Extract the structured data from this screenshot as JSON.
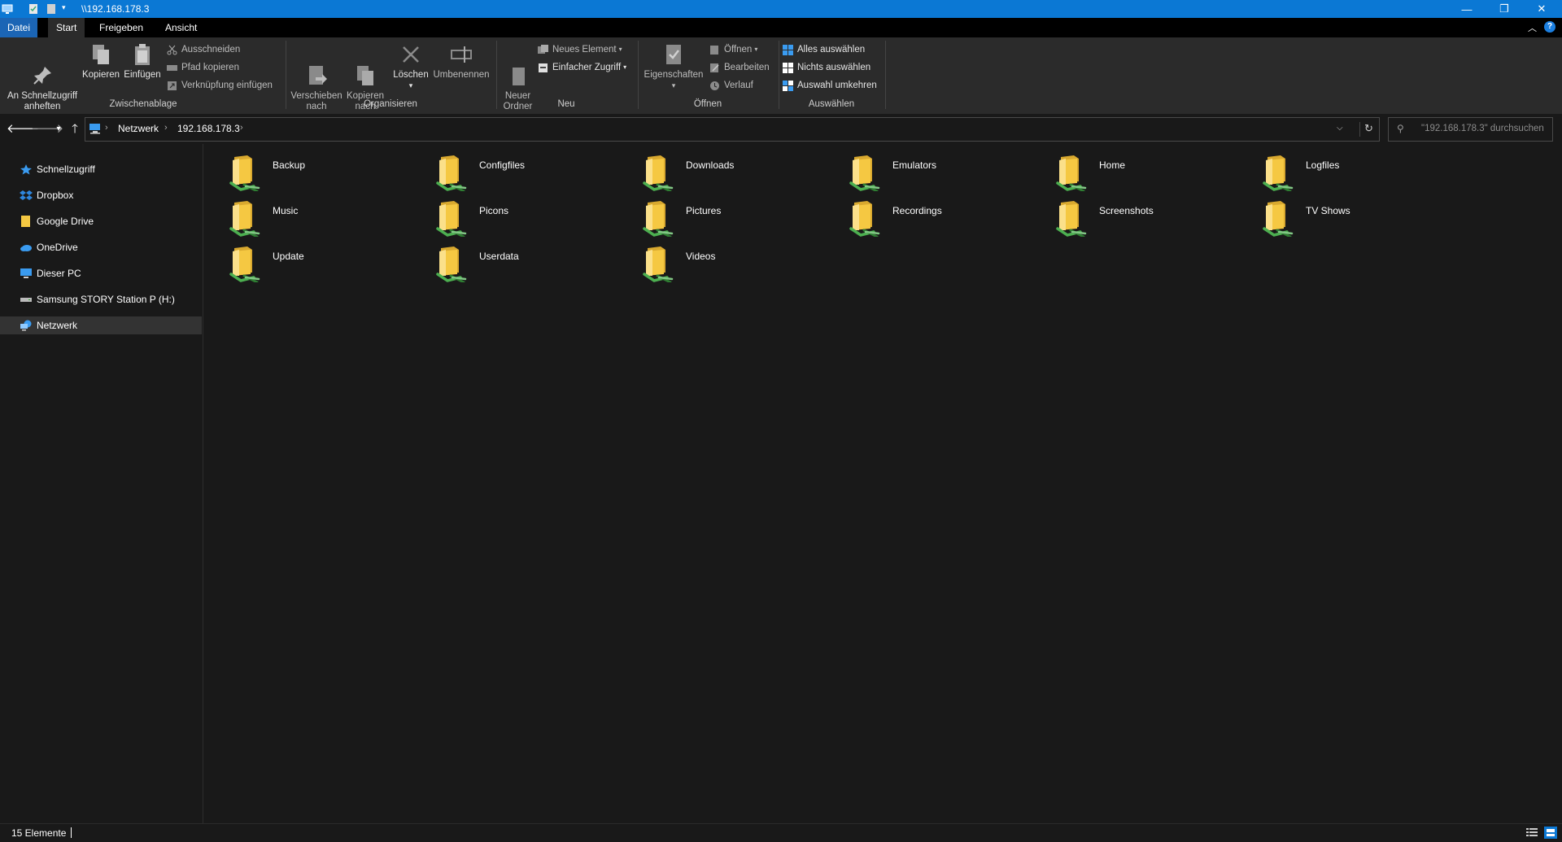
{
  "window": {
    "title": "\\\\192.168.178.3",
    "controls": [
      "minimize",
      "restore",
      "close"
    ]
  },
  "ribbon_tabs": [
    {
      "label": "Datei"
    },
    {
      "label": "Start"
    },
    {
      "label": "Freigeben"
    },
    {
      "label": "Ansicht"
    }
  ],
  "ribbon": {
    "pin_quick_access": "An Schnellzugriff\nanheften",
    "copy": "Kopieren",
    "paste": "Einfügen",
    "cut": "Ausschneiden",
    "copy_path": "Pfad kopieren",
    "paste_shortcut": "Verknüpfung einfügen",
    "group_clipboard": "Zwischenablage",
    "move_to": "Verschieben\nnach",
    "copy_to": "Kopieren\nnach",
    "delete": "Löschen",
    "rename": "Umbenennen",
    "group_organize": "Organisieren",
    "new_folder": "Neuer\nOrdner",
    "new_item": "Neues Element",
    "easy_access": "Einfacher Zugriff",
    "group_new": "Neu",
    "properties": "Eigenschaften",
    "open": "Öffnen",
    "edit": "Bearbeiten",
    "history": "Verlauf",
    "group_open": "Öffnen",
    "select_all": "Alles auswählen",
    "select_none": "Nichts auswählen",
    "invert_selection": "Auswahl umkehren",
    "group_select": "Auswählen"
  },
  "address": {
    "crumbs": [
      "Netzwerk",
      "192.168.178.3"
    ],
    "search_placeholder": "\"192.168.178.3\" durchsuchen"
  },
  "sidebar": {
    "items": [
      {
        "label": "Schnellzugriff",
        "icon": "star-icon"
      },
      {
        "label": "Dropbox",
        "icon": "dropbox-icon"
      },
      {
        "label": "Google Drive",
        "icon": "folder-icon"
      },
      {
        "label": "OneDrive",
        "icon": "cloud-icon"
      },
      {
        "label": "Dieser PC",
        "icon": "computer-icon"
      },
      {
        "label": "Samsung STORY Station P (H:)",
        "icon": "drive-icon"
      },
      {
        "label": "Netzwerk",
        "icon": "network-icon",
        "selected": true
      }
    ]
  },
  "folders": [
    {
      "name": "Backup"
    },
    {
      "name": "Configfiles"
    },
    {
      "name": "Downloads"
    },
    {
      "name": "Emulators"
    },
    {
      "name": "Home"
    },
    {
      "name": "Logfiles"
    },
    {
      "name": "Music"
    },
    {
      "name": "Picons"
    },
    {
      "name": "Pictures"
    },
    {
      "name": "Recordings"
    },
    {
      "name": "Screenshots"
    },
    {
      "name": "TV Shows"
    },
    {
      "name": "Update"
    },
    {
      "name": "Userdata"
    },
    {
      "name": "Videos"
    }
  ],
  "status": {
    "count": "15 Elemente"
  },
  "colors": {
    "titlebar": "#0b78d4",
    "file_tab": "#1b65b5",
    "background": "#191919",
    "ribbon": "#2b2b2b",
    "folder_yellow": "#f5c842",
    "share_green": "#4caf50"
  }
}
